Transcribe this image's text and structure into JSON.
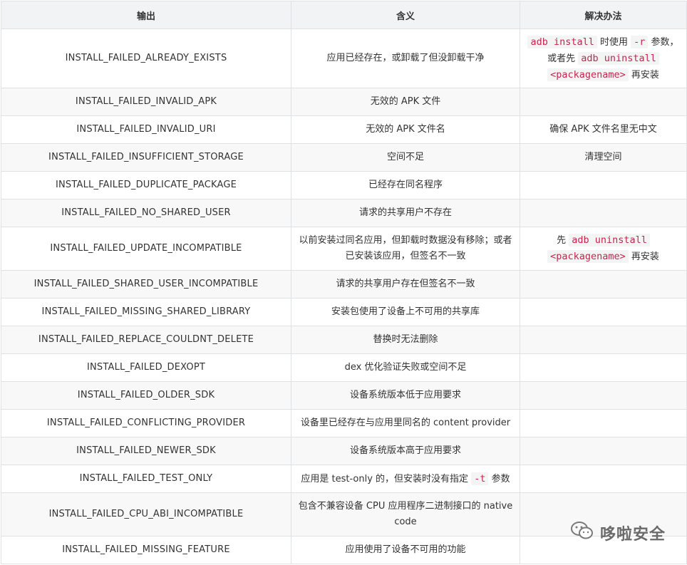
{
  "header": {
    "col1": "输出",
    "col2": "含义",
    "col3": "解决办法"
  },
  "rows": [
    {
      "output": "INSTALL_FAILED_ALREADY_EXISTS",
      "meaning": "应用已经存在，或卸载了但没卸载干净",
      "solution": {
        "parts": [
          {
            "code": "adb install"
          },
          {
            "text": " 时使用 "
          },
          {
            "code": "-r"
          },
          {
            "text": " 参数，或者先 "
          },
          {
            "code": "adb uninstall"
          },
          {
            "text": " "
          },
          {
            "code": "<packagename>"
          },
          {
            "text": " 再安装"
          }
        ]
      }
    },
    {
      "output": "INSTALL_FAILED_INVALID_APK",
      "meaning": "无效的 APK 文件",
      "solution": ""
    },
    {
      "output": "INSTALL_FAILED_INVALID_URI",
      "meaning": "无效的 APK 文件名",
      "solution": "确保 APK 文件名里无中文"
    },
    {
      "output": "INSTALL_FAILED_INSUFFICIENT_STORAGE",
      "meaning": "空间不足",
      "solution": "清理空间"
    },
    {
      "output": "INSTALL_FAILED_DUPLICATE_PACKAGE",
      "meaning": "已经存在同名程序",
      "solution": ""
    },
    {
      "output": "INSTALL_FAILED_NO_SHARED_USER",
      "meaning": "请求的共享用户不存在",
      "solution": ""
    },
    {
      "output": "INSTALL_FAILED_UPDATE_INCOMPATIBLE",
      "meaning": "以前安装过同名应用，但卸载时数据没有移除；或者已安装该应用，但签名不一致",
      "solution": {
        "parts": [
          {
            "text": "先 "
          },
          {
            "code": "adb uninstall"
          },
          {
            "text": " "
          },
          {
            "code": "<packagename>"
          },
          {
            "text": " 再安装"
          }
        ]
      }
    },
    {
      "output": "INSTALL_FAILED_SHARED_USER_INCOMPATIBLE",
      "meaning": "请求的共享用户存在但签名不一致",
      "solution": ""
    },
    {
      "output": "INSTALL_FAILED_MISSING_SHARED_LIBRARY",
      "meaning": "安装包使用了设备上不可用的共享库",
      "solution": ""
    },
    {
      "output": "INSTALL_FAILED_REPLACE_COULDNT_DELETE",
      "meaning": "替换时无法删除",
      "solution": ""
    },
    {
      "output": "INSTALL_FAILED_DEXOPT",
      "meaning": "dex 优化验证失败或空间不足",
      "solution": ""
    },
    {
      "output": "INSTALL_FAILED_OLDER_SDK",
      "meaning": "设备系统版本低于应用要求",
      "solution": ""
    },
    {
      "output": "INSTALL_FAILED_CONFLICTING_PROVIDER",
      "meaning": "设备里已经存在与应用里同名的 content provider",
      "solution": ""
    },
    {
      "output": "INSTALL_FAILED_NEWER_SDK",
      "meaning": "设备系统版本高于应用要求",
      "solution": ""
    },
    {
      "output": "INSTALL_FAILED_TEST_ONLY",
      "meaning": {
        "parts": [
          {
            "text": "应用是 test-only 的，但安装时没有指定 "
          },
          {
            "code": "-t"
          },
          {
            "text": " 参数"
          }
        ]
      },
      "solution": ""
    },
    {
      "output": "INSTALL_FAILED_CPU_ABI_INCOMPATIBLE",
      "meaning": "包含不兼容设备 CPU 应用程序二进制接口的 native code",
      "solution": ""
    },
    {
      "output": "INSTALL_FAILED_MISSING_FEATURE",
      "meaning": "应用使用了设备不可用的功能",
      "solution": ""
    }
  ],
  "watermark": {
    "text": "哆啦安全",
    "icon": "wechat-icon"
  }
}
